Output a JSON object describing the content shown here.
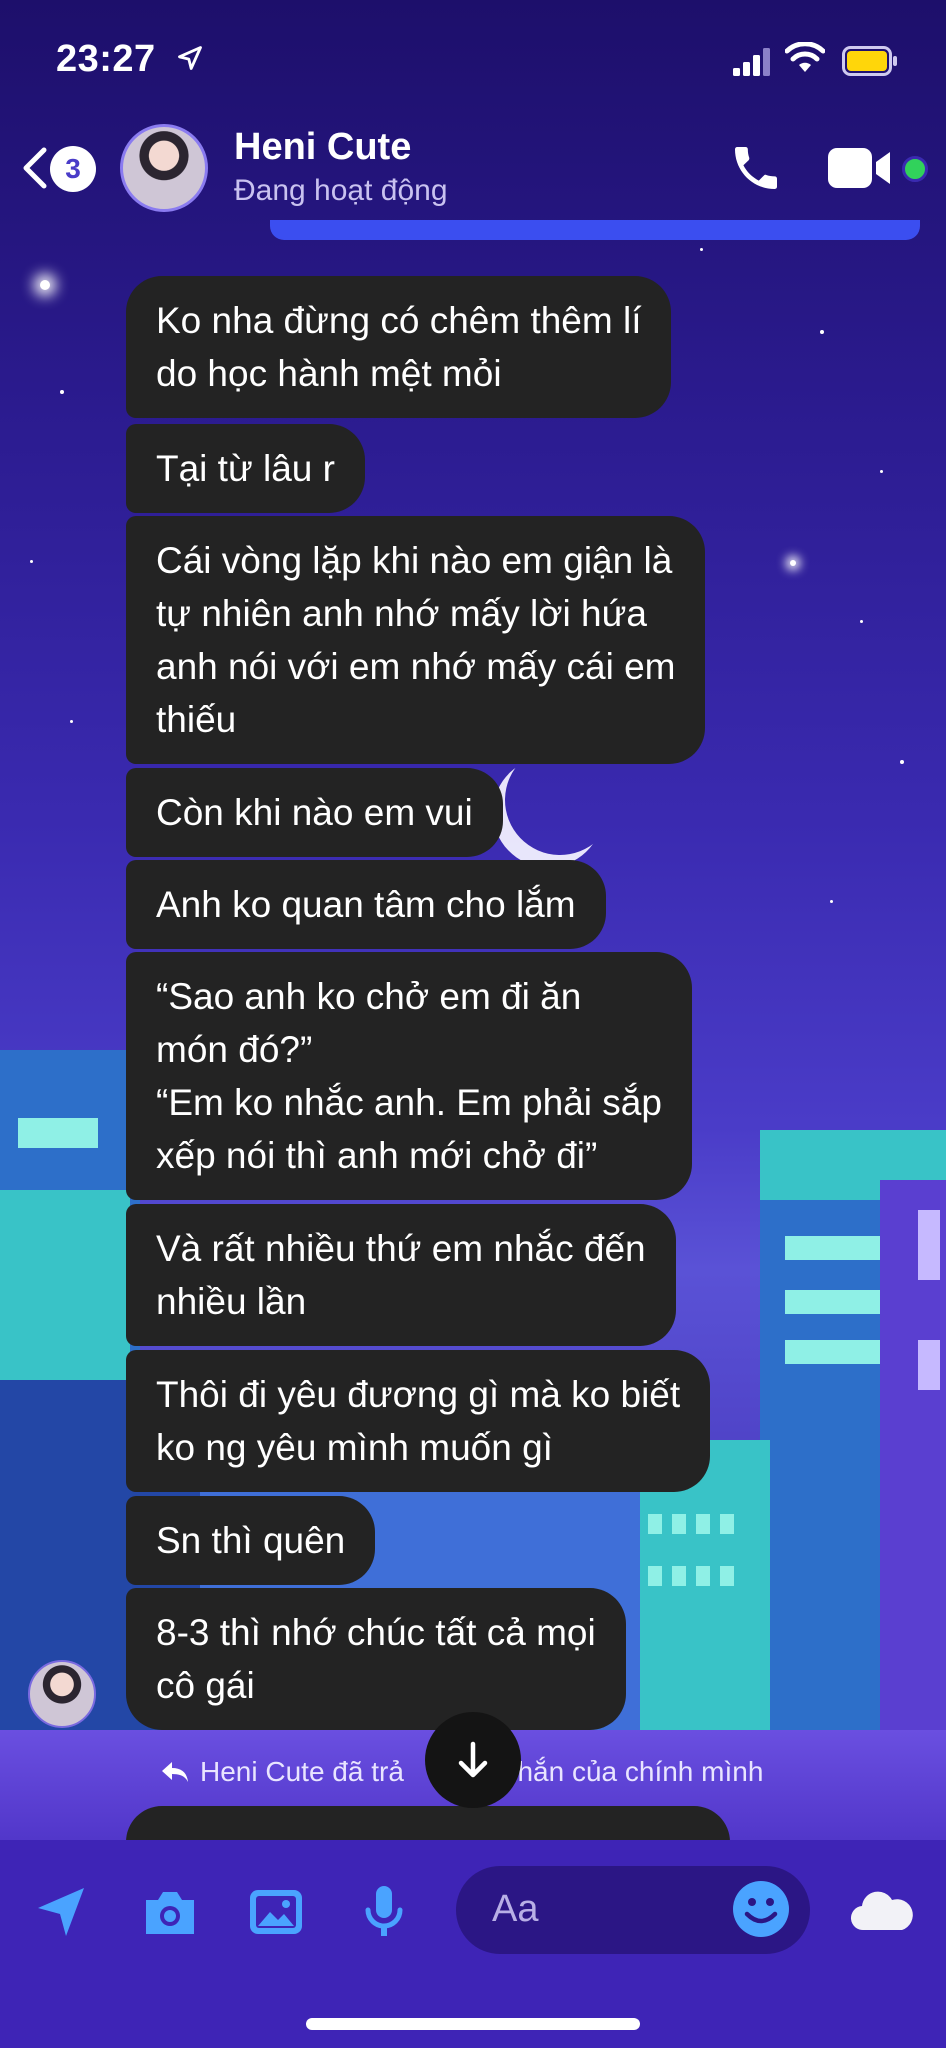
{
  "status_bar": {
    "time": "23:27"
  },
  "header": {
    "back_count": "3",
    "contact_name": "Heni Cute",
    "contact_status": "Đang hoạt động"
  },
  "messages": [
    "Ko nha đừng có chêm thêm lí\ndo học hành mệt mỏi",
    "Tại từ lâu r",
    "Cái vòng lặp khi nào em giận là\ntự nhiên anh nhớ mấy lời hứa\nanh nói với em nhớ mấy cái em\nthiếu",
    "Còn khi nào em vui",
    "Anh ko quan tâm cho lắm",
    "“Sao anh ko chở em đi ăn\nmón đó?”\n“Em ko nhắc anh. Em phải sắp\nxếp nói thì anh mới chở đi”",
    "Và rất nhiều thứ em nhắc đến\nnhiều lần",
    "Thôi đi yêu đương gì mà ko biết\nko ng yêu mình muốn gì",
    "Sn thì quên",
    "8-3 thì nhớ chúc tất cả mọi\ncô gái"
  ],
  "reply_note": {
    "left": "Heni Cute đã trả",
    "right": "nhắn của chính mình"
  },
  "composer": {
    "placeholder": "Aa"
  },
  "colors": {
    "bubble": "#232323",
    "online": "#31d25b",
    "accent": "#4a3cc8"
  },
  "icons": [
    "location-arrow-icon",
    "signal-icon",
    "wifi-icon",
    "battery-icon",
    "back-chevron-icon",
    "phone-icon",
    "video-icon",
    "reply-icon",
    "arrow-down-icon",
    "send-location-icon",
    "camera-icon",
    "gallery-icon",
    "microphone-icon",
    "emoji-icon",
    "weather-cloud-icon"
  ]
}
